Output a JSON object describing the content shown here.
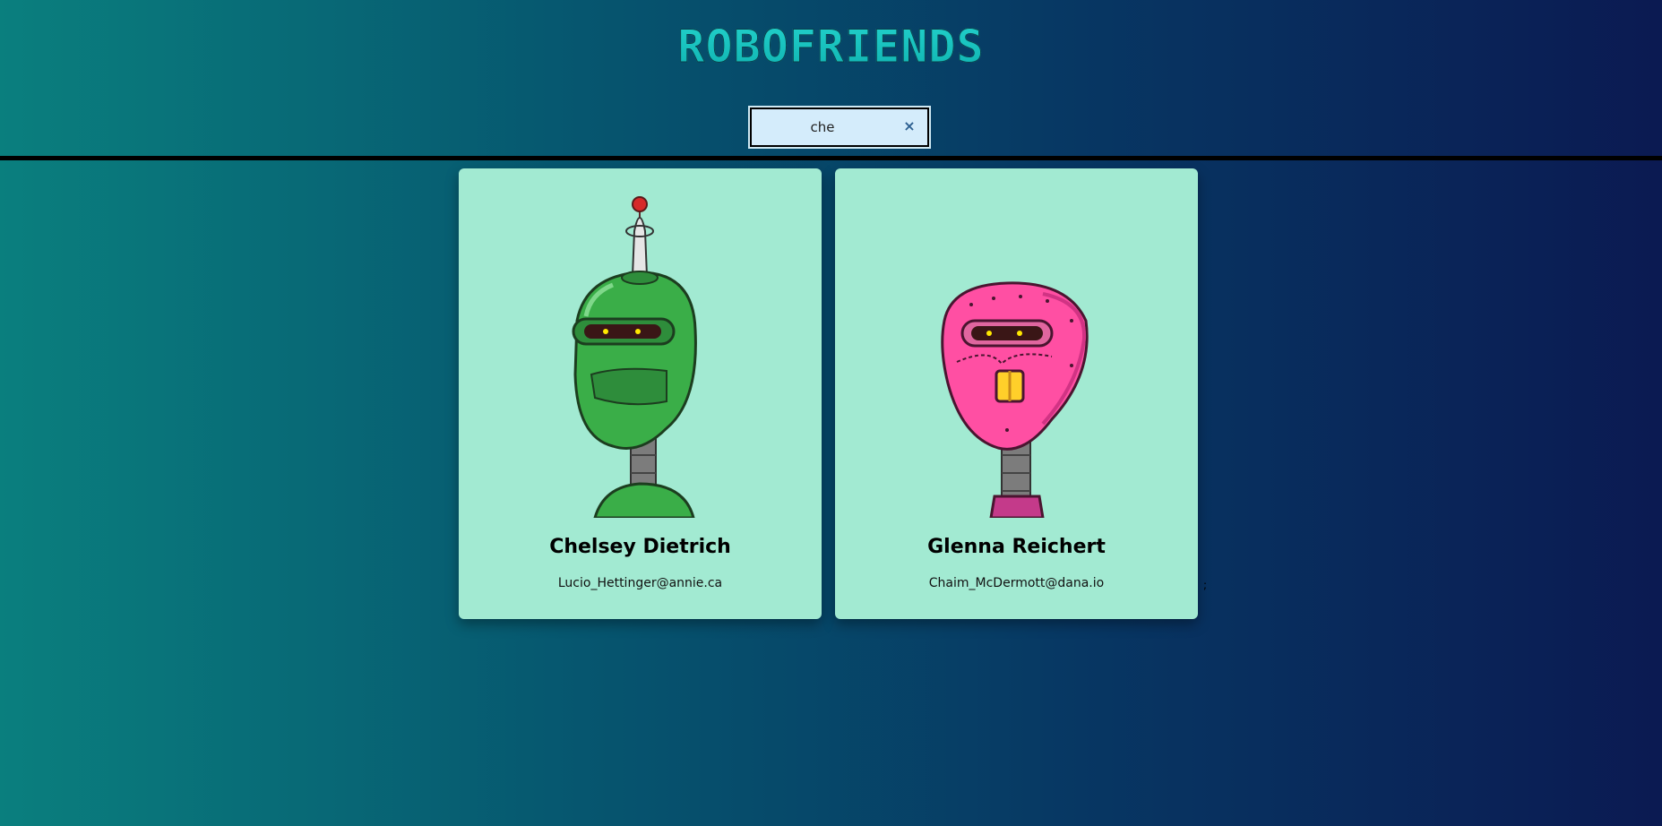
{
  "header": {
    "title": "ROBOFRIENDS"
  },
  "search": {
    "value": "che",
    "clear_icon": "close-icon",
    "clear_glyph": "×"
  },
  "robots": [
    {
      "name": "Chelsey Dietrich",
      "email": "Lucio_Hettinger@annie.ca",
      "color": "#3aae48",
      "avatar": "green-robot-avatar"
    },
    {
      "name": "Glenna Reichert",
      "email": "Chaim_McDermott@dana.io",
      "color": "#ff4fa3",
      "avatar": "pink-robot-avatar"
    }
  ],
  "colors": {
    "card_background": "#a2ead2",
    "search_background": "#d4ecfb",
    "logo": "#13c7c2"
  },
  "stray_mark": ";"
}
